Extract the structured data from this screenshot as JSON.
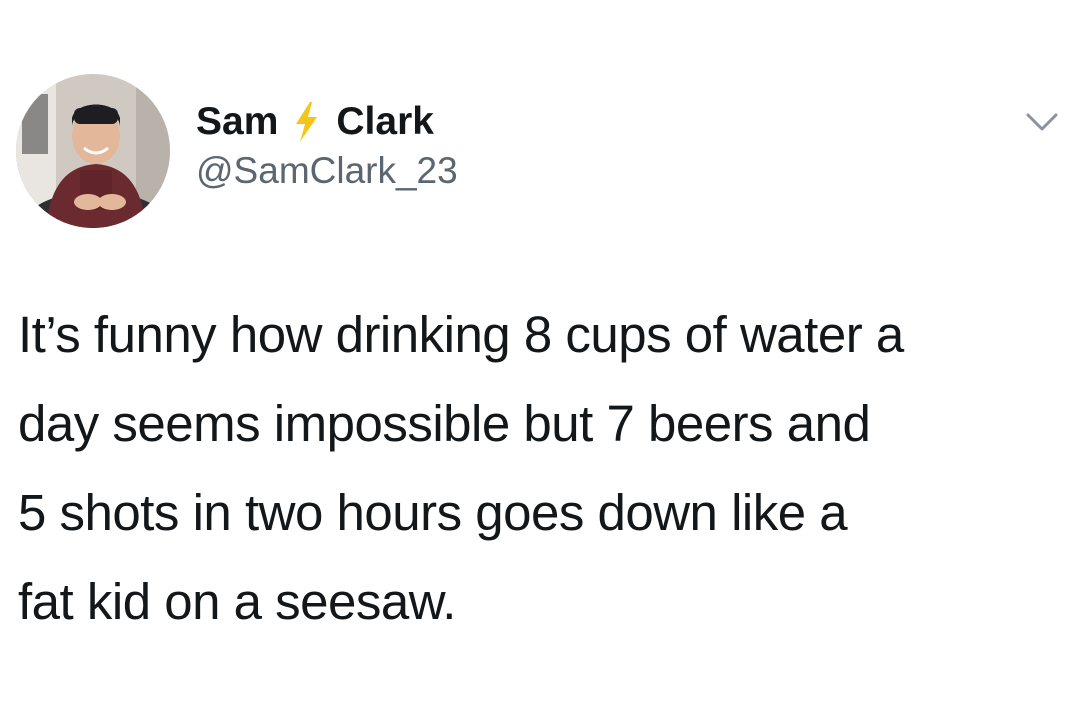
{
  "author": {
    "first_name": "Sam",
    "last_name": "Clark",
    "name_emoji_icon": "lightning-bolt-icon",
    "handle": "@SamClark_23",
    "avatar_icon": "profile-photo"
  },
  "menu": {
    "icon": "chevron-down-icon"
  },
  "tweet": {
    "lines": [
      "It’s funny how drinking 8 cups of water a",
      "day seems impossible but 7 beers and",
      "5 shots in two hours goes down like a",
      "fat kid on a seesaw."
    ]
  },
  "colors": {
    "text": "#14171a",
    "secondary": "#5b6670",
    "bolt": "#f5c518",
    "chevron": "#8a949c"
  }
}
